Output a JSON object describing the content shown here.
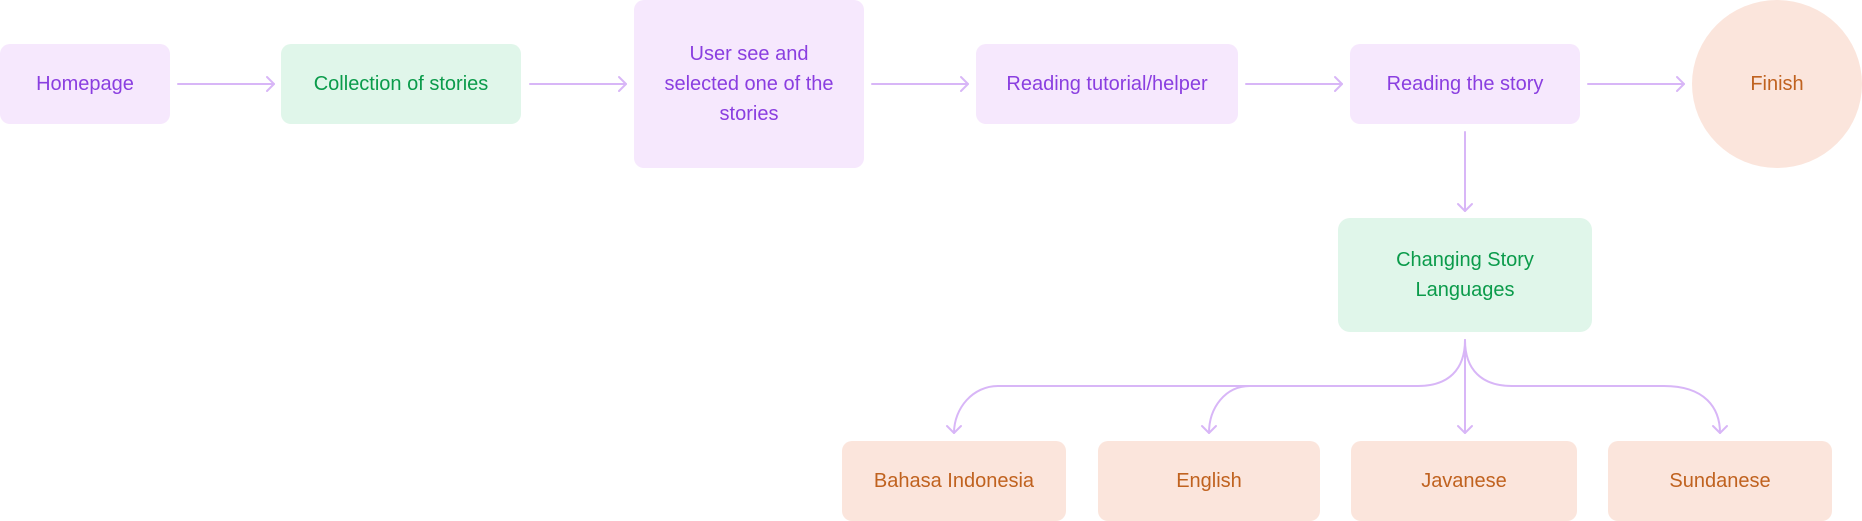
{
  "diagram": {
    "type": "flowchart",
    "colors": {
      "purple_fill": "#f6e8fd",
      "purple_text": "#8a3ee0",
      "green_fill": "#e0f6ea",
      "green_text": "#0b9b4b",
      "orange_fill": "#fbe5dc",
      "orange_text": "#c0621f",
      "edge": "#d8b6f7"
    },
    "nodes": {
      "homepage": "Homepage",
      "collection": "Collection of stories",
      "select_story": "User see and selected one of the stories",
      "tutorial": "Reading tutorial/helper",
      "reading": "Reading the story",
      "finish": "Finish",
      "change_language": "Changing Story Languages",
      "bahasa": "Bahasa Indonesia",
      "english": "English",
      "javanese": "Javanese",
      "sundanese": "Sundanese"
    },
    "edges": [
      [
        "homepage",
        "collection"
      ],
      [
        "collection",
        "select_story"
      ],
      [
        "select_story",
        "tutorial"
      ],
      [
        "tutorial",
        "reading"
      ],
      [
        "reading",
        "finish"
      ],
      [
        "reading",
        "change_language"
      ],
      [
        "change_language",
        "bahasa"
      ],
      [
        "change_language",
        "english"
      ],
      [
        "change_language",
        "javanese"
      ],
      [
        "change_language",
        "sundanese"
      ]
    ]
  }
}
